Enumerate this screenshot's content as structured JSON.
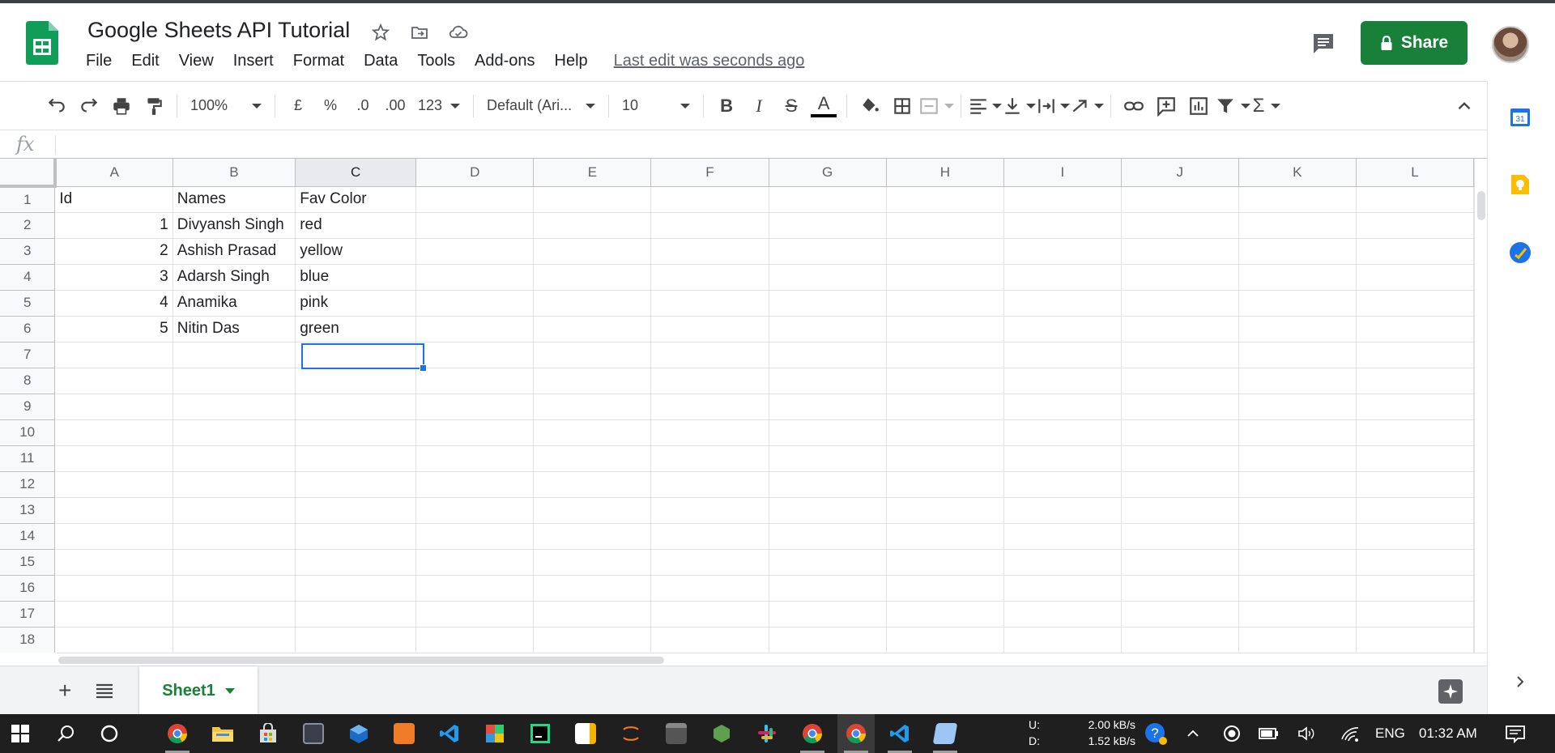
{
  "doc": {
    "title": "Google Sheets API Tutorial",
    "last_edit": "Last edit was seconds ago"
  },
  "menu": [
    "File",
    "Edit",
    "View",
    "Insert",
    "Format",
    "Data",
    "Tools",
    "Add-ons",
    "Help"
  ],
  "share_label": "Share",
  "toolbar": {
    "zoom": "100%",
    "currency": "£",
    "percent": "%",
    "dec_decrease": ".0",
    "dec_increase": ".00",
    "more_formats": "123",
    "font": "Default (Ari...",
    "font_size": "10",
    "text_color": "#000000"
  },
  "formula_bar": {
    "fx_label": "fx",
    "value": ""
  },
  "grid": {
    "columns": [
      "A",
      "B",
      "C",
      "D",
      "E",
      "F",
      "G",
      "H",
      "I",
      "J",
      "K",
      "L"
    ],
    "selected_column": "C",
    "row_numbers": [
      "1",
      "2",
      "3",
      "4",
      "5",
      "6",
      "7",
      "8",
      "9",
      "10",
      "11",
      "12",
      "13",
      "14",
      "15",
      "16",
      "17",
      "18"
    ],
    "rows": [
      [
        "Id",
        "Names",
        "Fav Color"
      ],
      [
        "1",
        "Divyansh Singh",
        "red"
      ],
      [
        "2",
        "Ashish Prasad",
        "yellow"
      ],
      [
        "3",
        "Adarsh Singh",
        "blue"
      ],
      [
        "4",
        "Anamika",
        "pink"
      ],
      [
        "5",
        "Nitin Das",
        "green"
      ]
    ],
    "active_cell": "C7"
  },
  "sheets": [
    {
      "name": "Sheet1",
      "active": true
    }
  ],
  "side_panel": [
    "calendar-icon",
    "keep-icon",
    "tasks-icon"
  ],
  "taskbar": {
    "net_up_label": "U:",
    "net_up_value": "2.00 kB/s",
    "net_down_label": "D:",
    "net_down_value": "1.52 kB/s",
    "language": "ENG",
    "time": "01:32 AM"
  },
  "colors": {
    "brand_green": "#188038",
    "accent_blue": "#1a73e8",
    "sheets_green": "#0f9d58"
  }
}
